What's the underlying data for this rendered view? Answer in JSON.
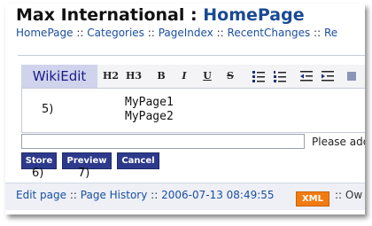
{
  "header": {
    "site_title": "Max International",
    "separator": ":",
    "page_name": "HomePage"
  },
  "breadcrumb": {
    "items": [
      "HomePage",
      "Categories",
      "PageIndex",
      "RecentChanges",
      "Re"
    ],
    "separator": "::"
  },
  "editor": {
    "label": "WikiEdit",
    "toolbar": {
      "h2": "H2",
      "h3": "H3",
      "bold": "B",
      "italic": "I",
      "underline": "U",
      "strike": "S",
      "icons": [
        "bulleted-list-icon",
        "numbered-list-icon",
        "outdent-icon",
        "indent-icon"
      ]
    },
    "marker_5": "5)",
    "content_lines": [
      "MyPage1",
      "MyPage2"
    ],
    "summary_input": {
      "value": "",
      "placeholder": ""
    },
    "summary_label": "Please ado"
  },
  "buttons": {
    "store": "Store",
    "preview": "Preview",
    "cancel": "Cancel",
    "marker_6": "6)",
    "marker_7": "7)"
  },
  "footer": {
    "edit_page": "Edit page",
    "page_history": "Page History",
    "timestamp": "2006-07-13 08:49:55",
    "separator": "::",
    "xml_badge": "XML",
    "tail": ":: Ow"
  },
  "colors": {
    "title_accent": "#1a4a92",
    "link": "#1b4fa0",
    "button_bg": "#2d3a8c",
    "toolbar_label_bg": "#cfd3ec",
    "xml_badge_bg": "#f27b10"
  }
}
